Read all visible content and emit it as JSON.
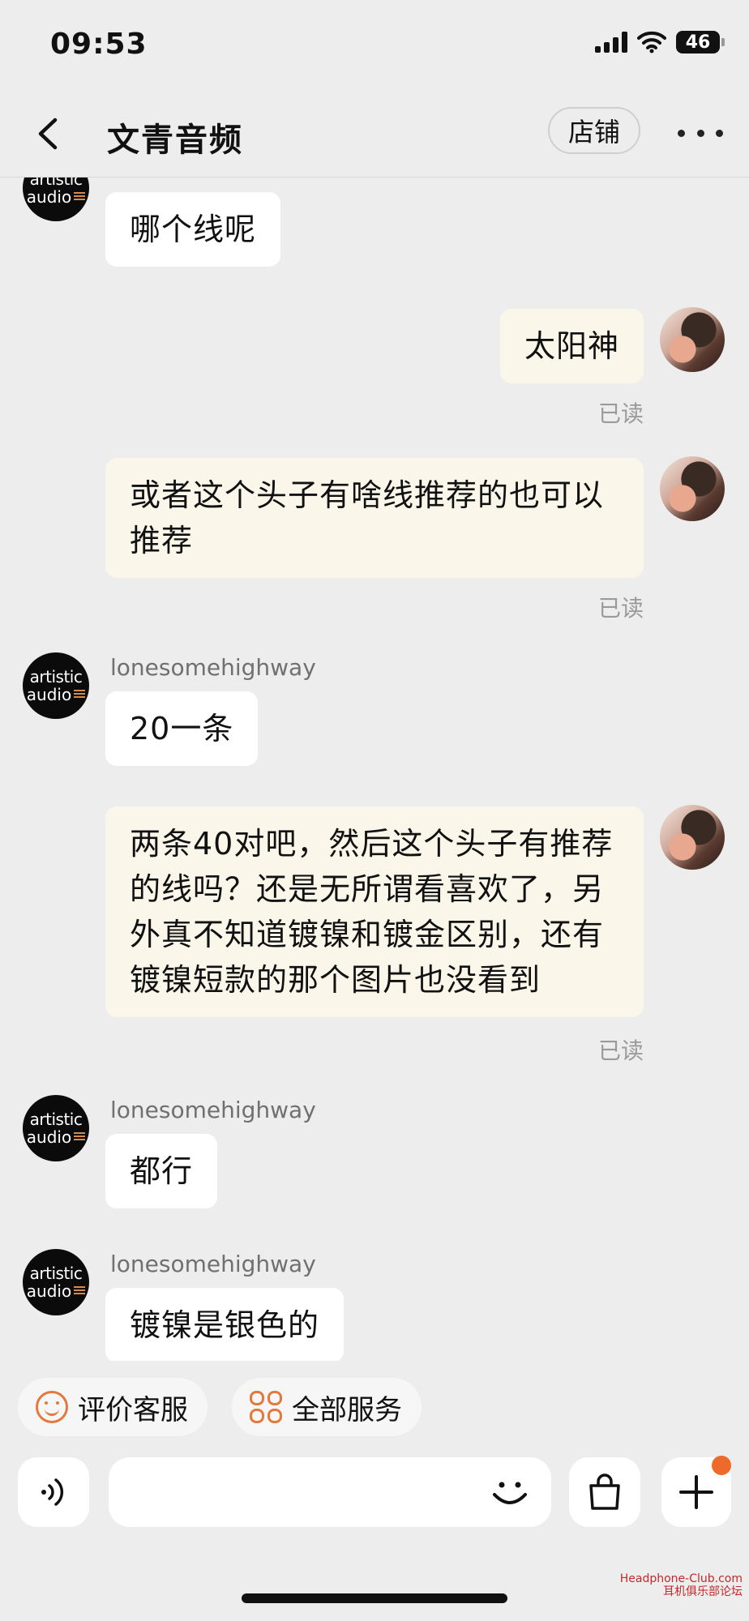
{
  "status_bar": {
    "time": "09:53",
    "battery": "46"
  },
  "header": {
    "title": "文青音频",
    "store_label": "店铺"
  },
  "messages": [
    {
      "side": "left",
      "sender": "",
      "text": "哪个线呢"
    },
    {
      "side": "right",
      "text": "太阳神",
      "status": "已读"
    },
    {
      "side": "right",
      "text": "或者这个头子有啥线推荐的也可以推荐",
      "status": "已读"
    },
    {
      "side": "left",
      "sender": "lonesomehighway",
      "text": "20一条"
    },
    {
      "side": "right",
      "text": "两条40对吧，然后这个头子有推荐的线吗？还是无所谓看喜欢了，另外真不知道镀镍和镀金区别，还有镀镍短款的那个图片也没看到",
      "status": "已读"
    },
    {
      "side": "left",
      "sender": "lonesomehighway",
      "text": "都行"
    },
    {
      "side": "left",
      "sender": "lonesomehighway",
      "text": "镀镍是银色的"
    }
  ],
  "shop_avatar": {
    "line1": "artistic",
    "line2": "audio"
  },
  "quick_actions": [
    {
      "icon": "smile-icon",
      "label": "评价客服"
    },
    {
      "icon": "grid-icon",
      "label": "全部服务"
    }
  ],
  "input": {
    "placeholder": ""
  },
  "watermark": {
    "line1": "Headphone-Club.com",
    "line2": "耳机俱乐部论坛"
  },
  "colors": {
    "background": "#ededed",
    "bubble_left": "#ffffff",
    "bubble_right": "#fbf6ea",
    "accent": "#e27a3f",
    "badge": "#ee6a2a"
  }
}
